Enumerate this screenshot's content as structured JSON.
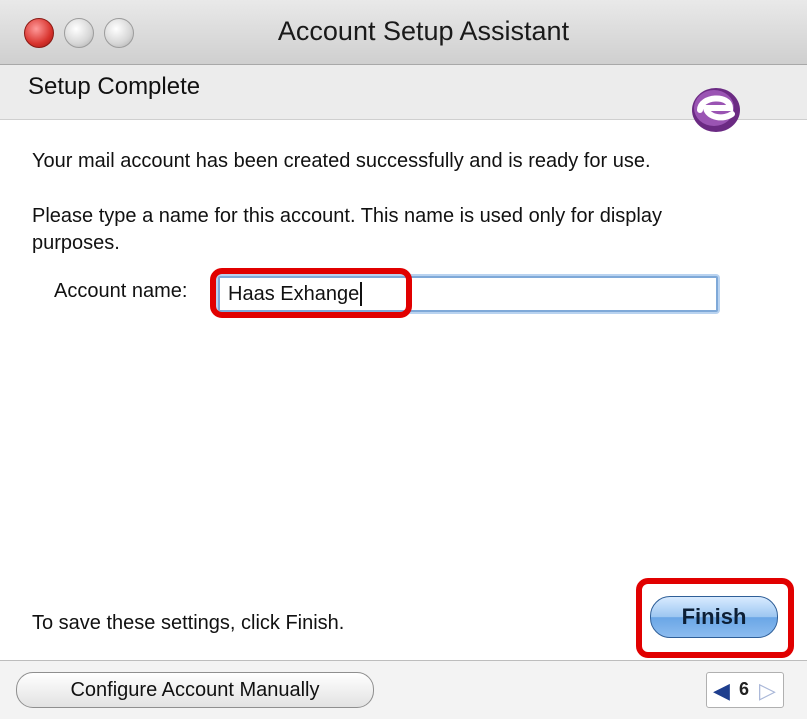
{
  "window": {
    "title": "Account Setup Assistant"
  },
  "header": {
    "title": "Setup Complete"
  },
  "main": {
    "message": "Your mail account has been created successfully and is ready for use.",
    "instruction": "Please type a name for this account. This name is used only for display purposes.",
    "account_name_label": "Account name:",
    "account_name_value": "Haas Exhange",
    "finish_note": "To save these settings, click Finish.",
    "finish_label": "Finish"
  },
  "footer": {
    "manual_button_label": "Configure Account Manually",
    "page_number": "6",
    "prev_icon": "◀",
    "next_icon": "▷"
  },
  "colors": {
    "highlight": "#e10000",
    "logo": "#7b2c8f",
    "finish_button": "#8cbcef"
  }
}
